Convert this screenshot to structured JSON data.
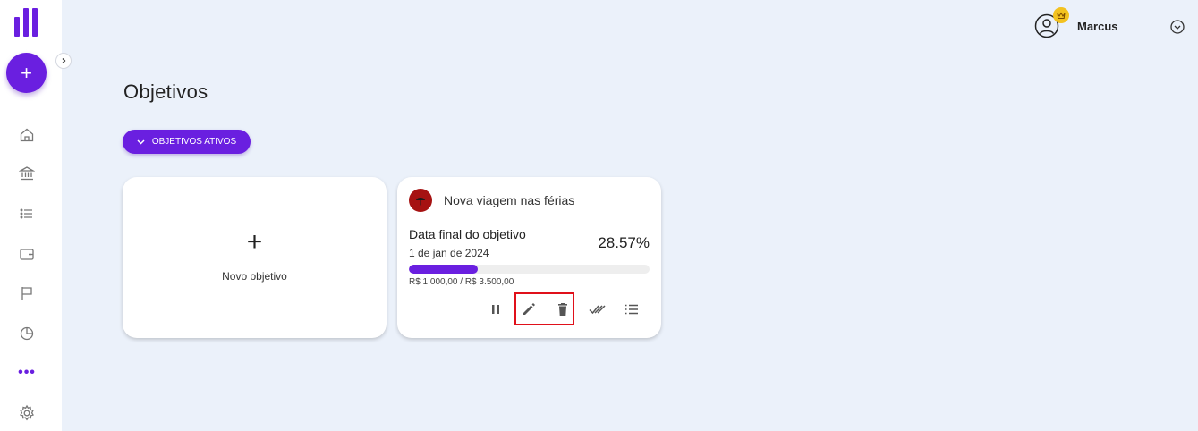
{
  "sidebar": {
    "fab_label": "+",
    "more_label": "•••",
    "nav_items": [
      "home-icon",
      "bank-icon",
      "list-icon",
      "wallet-icon",
      "flag-icon",
      "pie-chart-icon",
      "more-icon",
      "settings-icon"
    ]
  },
  "header": {
    "user_name": "Marcus"
  },
  "main": {
    "page_title": "Objetivos",
    "filter_label": "OBJETIVOS ATIVOS",
    "new_card": {
      "plus": "+",
      "label": "Novo objetivo"
    },
    "goal_card": {
      "title": "Nova viagem nas férias",
      "date_label": "Data final do objetivo",
      "date_value": "1 de jan de 2024",
      "percent_text": "28.57%",
      "progress": 0.2857,
      "amount_text": "R$ 1.000,00 / R$ 3.500,00",
      "actions": [
        "pause-icon",
        "edit-icon",
        "delete-icon",
        "done-all-icon",
        "list-icon"
      ]
    }
  },
  "colors": {
    "accent": "#6a1fe0",
    "background": "#ebf1fa",
    "crown": "#f3c220",
    "goal_icon": "#a61212",
    "highlight": "#e0101a"
  }
}
